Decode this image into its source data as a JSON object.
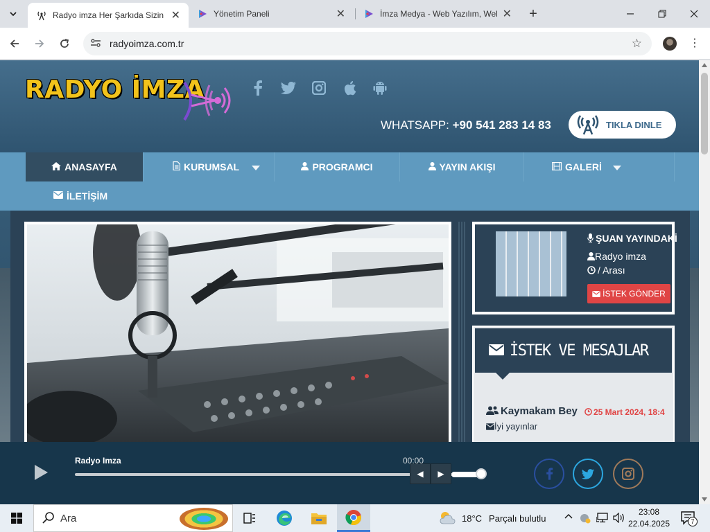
{
  "browser": {
    "tabs": [
      {
        "title": "Radyo imza Her Şarkıda Sizin de",
        "active": true
      },
      {
        "title": "Yönetim Paneli",
        "active": false
      },
      {
        "title": "İmza Medya - Web Yazılım, Web",
        "active": false
      }
    ],
    "url": "radyoimza.com.tr"
  },
  "site": {
    "logo_text": "RADYO İMZA",
    "whatsapp_label": "WHATSAPP:",
    "whatsapp_number": "+90 541 283 14 83",
    "listen_button": "TIKLA DINLE",
    "nav": [
      {
        "label": "ANASAYFA",
        "icon": "home-icon"
      },
      {
        "label": "KURUMSAL",
        "icon": "document-icon"
      },
      {
        "label": "PROGRAMCI",
        "icon": "user-icon"
      },
      {
        "label": "YAYIN AKIŞI",
        "icon": "user-icon"
      },
      {
        "label": "GALERİ",
        "icon": "film-icon"
      },
      {
        "label": "İLETİŞİM",
        "icon": "envelope-icon"
      }
    ],
    "now_playing": {
      "title": "ŞUAN YAYINDAKİ",
      "presenter": "Radyo imza",
      "time": "/ Arası",
      "request_button": "İSTEK GÖNDER"
    },
    "messages": {
      "title": "İSTEK VE MESAJLAR",
      "items": [
        {
          "author": "Kaymakam Bey",
          "date": "25 Mart 2024, 18:4",
          "text": "İyi yayınlar"
        }
      ]
    },
    "player": {
      "title": "Radyo Imza",
      "time": "00:00",
      "volume": 0.8
    }
  },
  "taskbar": {
    "search_placeholder": "Ara",
    "weather_temp": "18°C",
    "weather_desc": "Parçalı bulutlu",
    "time": "23:08",
    "date": "22.04.2025",
    "notification_count": "7"
  },
  "colors": {
    "accent": "#5f9abf",
    "nav_active": "#324d61",
    "danger": "#e04545",
    "logo_yellow": "#f2c31b"
  }
}
